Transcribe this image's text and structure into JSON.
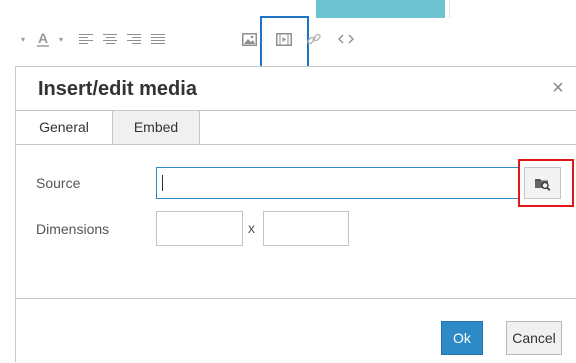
{
  "toolbar": {
    "font_color_label": "A",
    "caret": "▾",
    "items": [
      "font-color",
      "align-left",
      "align-center",
      "align-right",
      "align-justify",
      "image",
      "media",
      "link",
      "source-code"
    ],
    "accent_teal": "#6ec3d1",
    "highlight_blue": "#1f72c4"
  },
  "dialog": {
    "title": "Insert/edit media",
    "close_glyph": "×",
    "tabs": [
      {
        "label": "General",
        "active": true
      },
      {
        "label": "Embed",
        "active": false
      }
    ],
    "source": {
      "label": "Source",
      "value": ""
    },
    "dimensions": {
      "label": "Dimensions",
      "width": "",
      "height": "",
      "separator": "x"
    },
    "ok_label": "Ok",
    "cancel_label": "Cancel",
    "highlight_red": "#e01717",
    "primary_color": "#2d8ac7"
  }
}
